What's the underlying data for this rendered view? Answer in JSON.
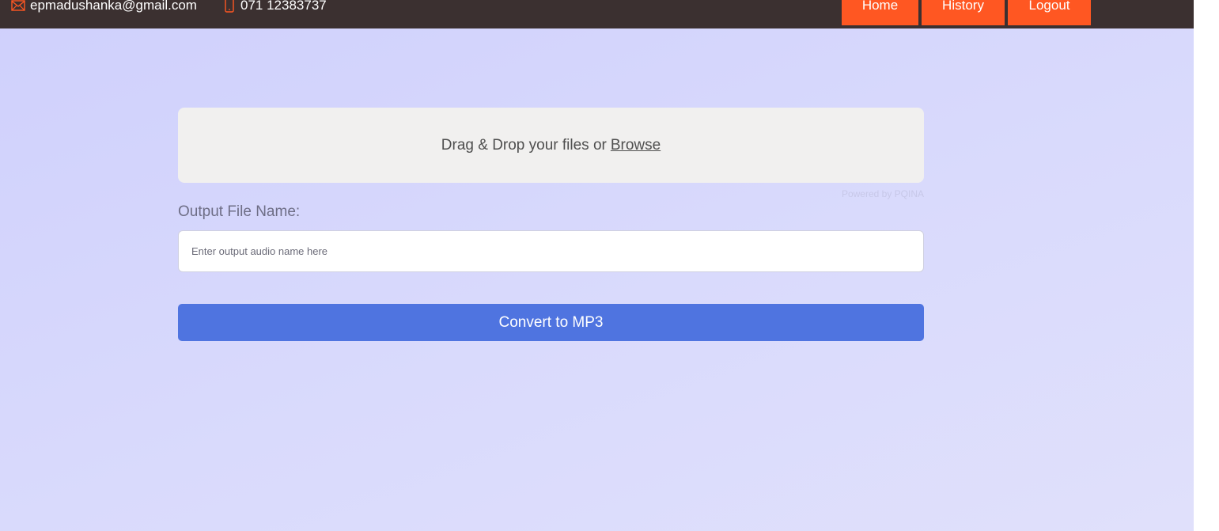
{
  "topbar": {
    "email": "epmadushanka@gmail.com",
    "phone": "071 12383737",
    "email_icon": "envelope-icon",
    "phone_icon": "mobile-phone-icon",
    "nav": {
      "home": "Home",
      "history": "History",
      "logout": "Logout"
    }
  },
  "upload": {
    "prompt": "Drag & Drop your files or",
    "browse_label": "Browse",
    "powered_by": "Powered by PQINA"
  },
  "form": {
    "output_label": "Output File Name:",
    "output_placeholder": "Enter output audio name here",
    "convert_label": "Convert to MP3"
  },
  "colors": {
    "topbar_bg": "#3b3030",
    "accent_orange": "#ff5722",
    "primary_blue": "#4f74e0",
    "page_bg": "#d6d6fc"
  }
}
